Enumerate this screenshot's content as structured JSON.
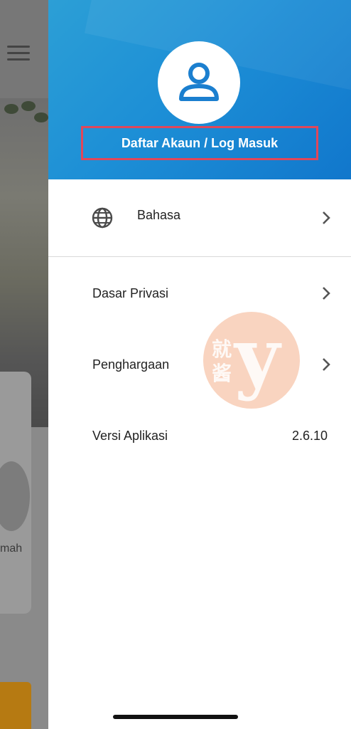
{
  "background": {
    "partial_label": "mah",
    "icons": [
      "hamburger-menu-icon"
    ]
  },
  "drawer": {
    "login_label": "Daftar Akaun / Log Masuk",
    "menu": {
      "language": {
        "label": "Bahasa",
        "icon": "globe-icon"
      },
      "privacy": {
        "label": "Dasar Privasi"
      },
      "awards": {
        "label": "Penghargaan"
      },
      "version": {
        "label": "Versi Aplikasi",
        "value": "2.6.10"
      }
    },
    "colors": {
      "header_blue": "#1d8fd6",
      "highlight_red": "#e0475a"
    }
  },
  "watermark": {
    "glyph": "y",
    "chars": "就酱"
  }
}
